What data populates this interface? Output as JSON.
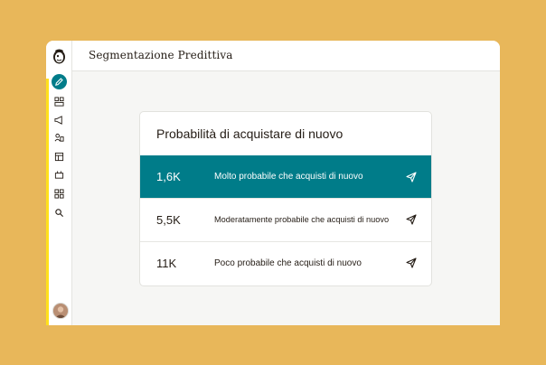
{
  "header": {
    "title": "Segmentazione Predittiva"
  },
  "sidebar": {
    "items": [
      {
        "name": "pencil-icon",
        "active": true
      },
      {
        "name": "dashboard-icon"
      },
      {
        "name": "megaphone-icon"
      },
      {
        "name": "audience-icon"
      },
      {
        "name": "content-icon"
      },
      {
        "name": "automation-icon"
      },
      {
        "name": "integrations-icon"
      },
      {
        "name": "search-icon"
      }
    ],
    "accent_color": "#ffe01b"
  },
  "card": {
    "title": "Probabilità di acquistare di nuovo",
    "rows": [
      {
        "value": "1,6K",
        "label": "Molto probabile che acquisti di nuovo",
        "highlighted": true
      },
      {
        "value": "5,5K",
        "label": "Moderatamente probabile che acquisti di nuovo"
      },
      {
        "value": "11K",
        "label": "Poco probabile che acquisti di nuovo"
      }
    ]
  },
  "colors": {
    "background": "#e8b75a",
    "accent": "#007c89"
  }
}
